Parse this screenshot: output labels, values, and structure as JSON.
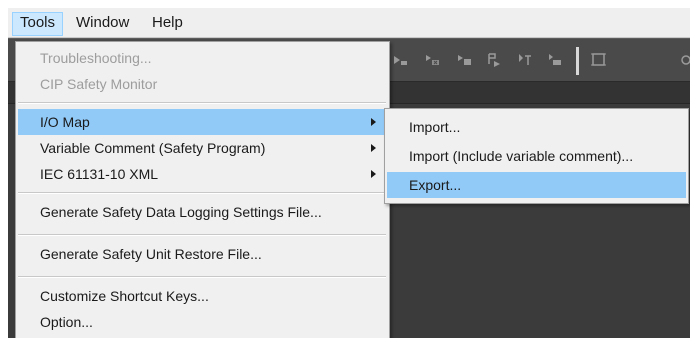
{
  "menubar": {
    "items": [
      {
        "label": "Tools",
        "active": true
      },
      {
        "label": "Window",
        "active": false
      },
      {
        "label": "Help",
        "active": false
      }
    ]
  },
  "tools_menu": {
    "items": [
      {
        "label": "Troubleshooting...",
        "disabled": true
      },
      {
        "label": "CIP Safety Monitor",
        "disabled": true
      },
      {
        "label": "I/O Map",
        "submenu": true,
        "highlighted": true
      },
      {
        "label": "Variable Comment (Safety Program)",
        "submenu": true
      },
      {
        "label": "IEC 61131-10 XML",
        "submenu": true
      },
      {
        "label": "Generate Safety Data Logging Settings File..."
      },
      {
        "label": "Generate Safety Unit Restore File..."
      },
      {
        "label": "Customize Shortcut Keys..."
      },
      {
        "label": "Option..."
      }
    ]
  },
  "io_map_submenu": {
    "items": [
      {
        "label": "Import..."
      },
      {
        "label": "Import (Include variable comment)..."
      },
      {
        "label": "Export...",
        "highlighted": true
      }
    ]
  },
  "colors": {
    "menu_highlight": "#91c9f7",
    "menubar_active": "#cce8ff",
    "menu_background": "#f0f0f0",
    "disabled_text": "#9d9d9d",
    "workspace_dark": "#3b3b3b"
  },
  "toolbar": {
    "icons": [
      "step-icon",
      "step-into-icon",
      "step-out-icon",
      "run-to-icon",
      "breakpoint-icon",
      "clear-breakpoint-icon",
      "frame-icon"
    ]
  }
}
